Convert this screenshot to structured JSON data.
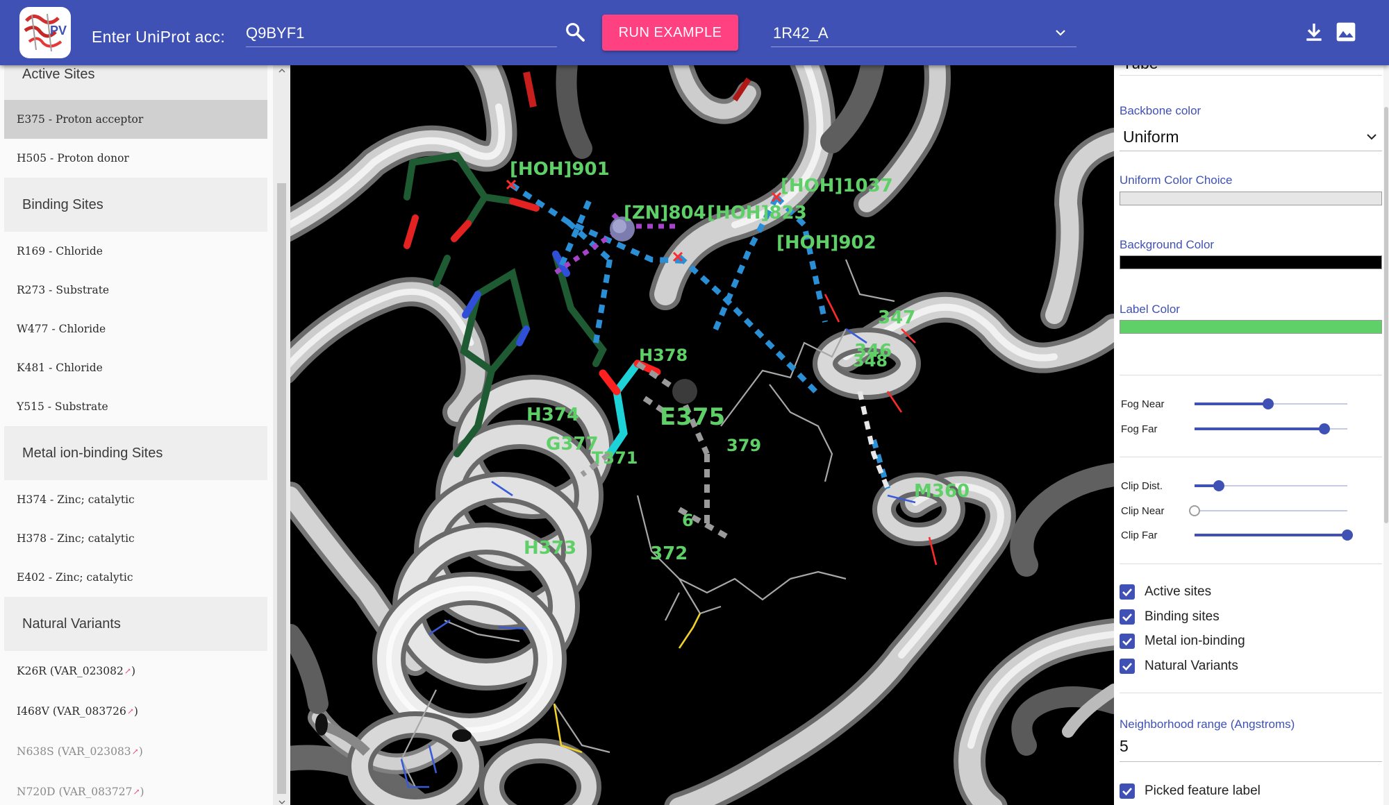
{
  "header": {
    "acc_label": "Enter UniProt acc:",
    "acc_value": "Q9BYF1",
    "run_button": "RUN EXAMPLE",
    "pdb_selected": "1R42_A",
    "brand_color": "#3f51b5",
    "accent_color": "#ff4081",
    "icons": [
      "search-icon",
      "download-icon",
      "image-icon",
      "chevron-down-icon"
    ]
  },
  "sidebar": {
    "sections": [
      {
        "title": "Active Sites",
        "items": [
          {
            "label": "E375 - Proton acceptor",
            "selected": true
          },
          {
            "label": "H505 - Proton donor"
          }
        ]
      },
      {
        "title": "Binding Sites",
        "items": [
          {
            "label": "R169 - Chloride"
          },
          {
            "label": "R273 - Substrate"
          },
          {
            "label": "W477 - Chloride"
          },
          {
            "label": "K481 - Chloride"
          },
          {
            "label": "Y515 - Substrate"
          }
        ]
      },
      {
        "title": "Metal ion-binding Sites",
        "items": [
          {
            "label": "H374 - Zinc; catalytic"
          },
          {
            "label": "H378 - Zinc; catalytic"
          },
          {
            "label": "E402 - Zinc; catalytic"
          }
        ]
      },
      {
        "title": "Natural Variants",
        "items": [
          {
            "label": "K26R (VAR_023082",
            "suffix": "↗",
            "close": ")"
          },
          {
            "label": "I468V (VAR_083726",
            "suffix": "↗",
            "close": ")"
          },
          {
            "label": "N638S (VAR_023083",
            "suffix": "↗",
            "close": ")",
            "faded": true
          },
          {
            "label": "N720D (VAR_083727",
            "suffix": "↗",
            "close": ")",
            "faded": true
          }
        ]
      }
    ]
  },
  "viewer": {
    "background": "#000000",
    "label_color": "#5fd068",
    "labels": {
      "hoh901": "[HOH]901",
      "hoh1037": "[HOH]1037",
      "zn804": "[ZN]804",
      "hoh823": "[HOH]823",
      "hoh902": "[HOH]902",
      "r347": "347",
      "r346": "346",
      "r348": "348",
      "h378": "H378",
      "h374": "H374",
      "e375": "E375",
      "g377": "G377",
      "t371": "T371",
      "r379": "379",
      "m360": "M360",
      "r376": "6",
      "h373": "H373",
      "r372": "372"
    }
  },
  "panel": {
    "top_cut_value": "Tube",
    "backbone_color_label": "Backbone color",
    "backbone_color_value": "Uniform",
    "uniform_color_label": "Uniform Color Choice",
    "uniform_color": "#e6e6e6",
    "background_color_label": "Background Color",
    "background_color": "#000000",
    "label_color_label": "Label Color",
    "label_color": "#5fd068",
    "sliders": [
      {
        "label": "Fog Near",
        "value": 0.48
      },
      {
        "label": "Fog Far",
        "value": 0.85
      },
      {
        "label": "Clip Dist.",
        "value": 0.16
      },
      {
        "label": "Clip Near",
        "value": 0.0
      },
      {
        "label": "Clip Far",
        "value": 1.0
      }
    ],
    "checkboxes": [
      {
        "label": "Active sites",
        "checked": true
      },
      {
        "label": "Binding sites",
        "checked": true
      },
      {
        "label": "Metal ion-binding",
        "checked": true
      },
      {
        "label": "Natural Variants",
        "checked": true
      }
    ],
    "neighborhood_label": "Neighborhood range (Angstroms)",
    "neighborhood_value": "5",
    "picked_label": "Picked feature label",
    "picked_checked": true
  }
}
